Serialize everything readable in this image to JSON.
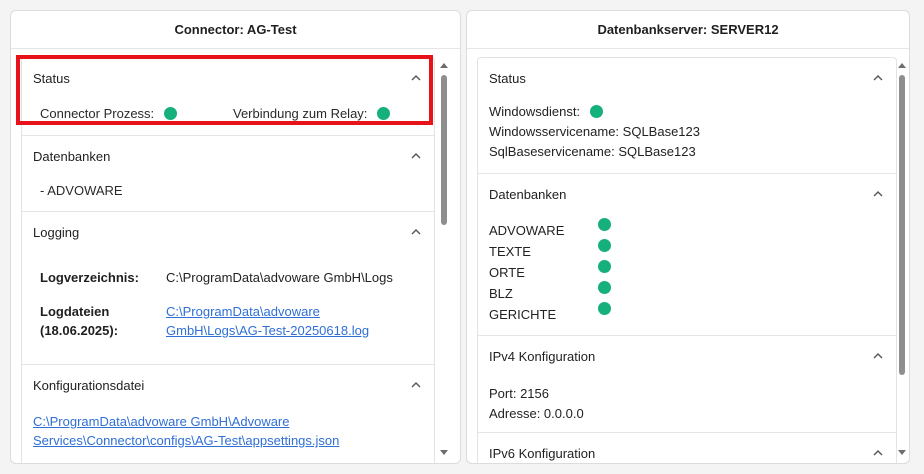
{
  "left": {
    "title": "Connector: AG-Test",
    "status": {
      "heading": "Status",
      "connector_process_label": "Connector Prozess:",
      "relay_label": "Verbindung zum Relay:"
    },
    "databases": {
      "heading": "Datenbanken",
      "items": [
        "- ADVOWARE"
      ]
    },
    "logging": {
      "heading": "Logging",
      "log_dir_label": "Logverzeichnis:",
      "log_dir_value": "C:\\ProgramData\\advoware GmbH\\Logs",
      "log_files_label_1": "Logdateien",
      "log_files_label_2": "(18.06.2025):",
      "log_file_line1": "C:\\ProgramData\\advoware",
      "log_file_line2": "GmbH\\Logs\\AG-Test-20250618.log"
    },
    "config": {
      "heading": "Konfigurationsdatei",
      "path_line1": "C:\\ProgramData\\advoware GmbH\\Advoware",
      "path_line2": "Services\\Connector\\configs\\AG-Test\\appsettings.json"
    }
  },
  "right": {
    "title": "Datenbankserver: SERVER12",
    "status": {
      "heading": "Status",
      "windows_service_label": "Windowsdienst:",
      "service_name_line": "Windowsservicename:  SQLBase123",
      "sqlbase_service_line": "SqlBaseservicename:  SQLBase123"
    },
    "databases": {
      "heading": "Datenbanken",
      "items": [
        "ADVOWARE",
        "TEXTE",
        "ORTE",
        "BLZ",
        "GERICHTE"
      ]
    },
    "ipv4": {
      "heading": "IPv4 Konfiguration",
      "port_line": "Port:  2156",
      "address_line": "Adresse:  0.0.0.0"
    },
    "ipv6": {
      "heading": "IPv6 Konfiguration"
    }
  },
  "colors": {
    "status_ok": "#16b07c",
    "link": "#2f6fd6",
    "highlight": "#e8131a"
  },
  "icons": [
    "chevron-up-icon",
    "status-dot-icon",
    "scroll-up-arrow-icon",
    "scroll-down-arrow-icon"
  ]
}
